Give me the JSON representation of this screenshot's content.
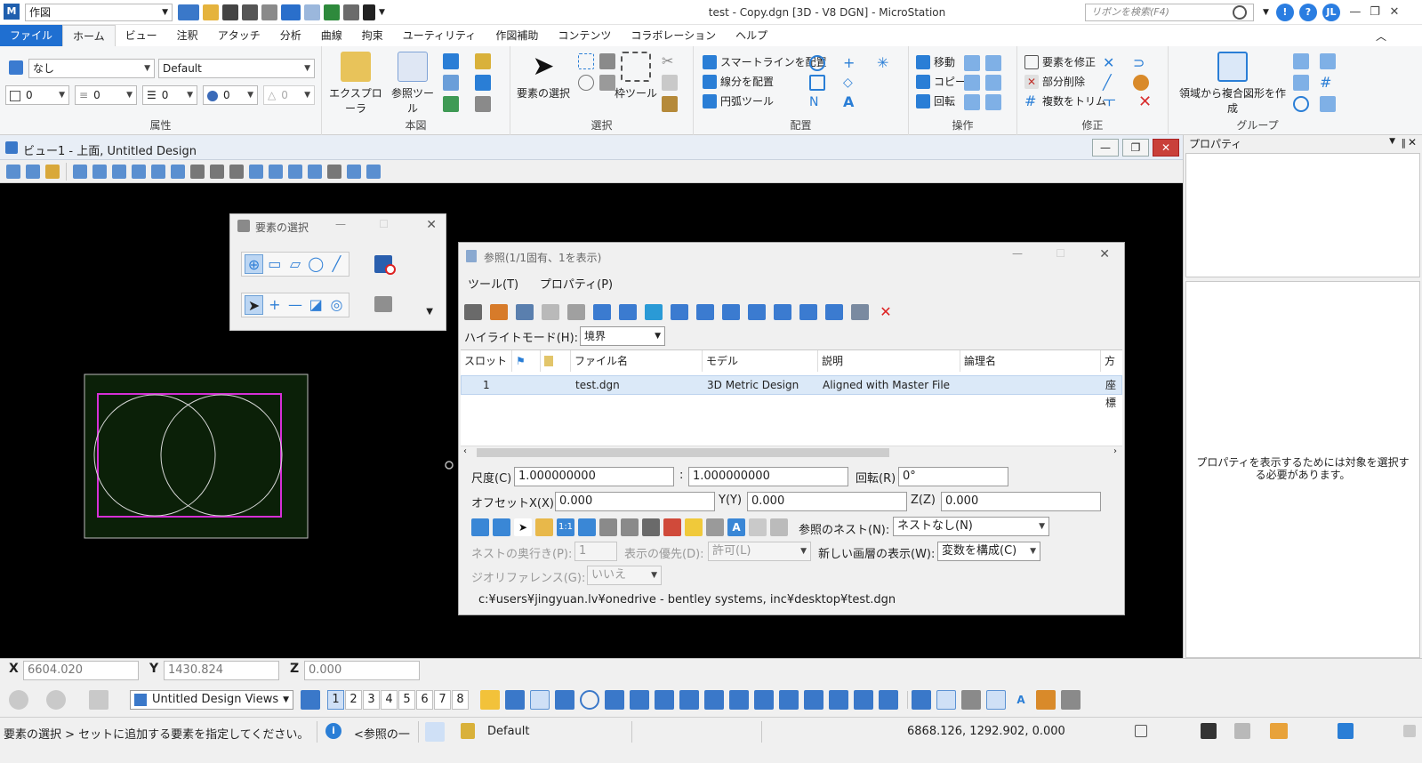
{
  "app": {
    "workflow": "作図",
    "window_title": "test - Copy.dgn [3D - V8 DGN] - MicroStation",
    "search_placeholder": "リボンを検索(F4)",
    "user_initials": "JL"
  },
  "tabs": [
    "ファイル",
    "ホーム",
    "ビュー",
    "注釈",
    "アタッチ",
    "分析",
    "曲線",
    "拘束",
    "ユーティリティ",
    "作図補助",
    "コンテンツ",
    "コラボレーション",
    "ヘルプ"
  ],
  "ribbon": {
    "attributes": {
      "level": "なし",
      "style": "Default",
      "color": "0",
      "linestyle": "0",
      "weight": "0",
      "transparency": "0",
      "priority": "0",
      "label": "属性"
    },
    "primary": {
      "explorer": "エクスプローラ",
      "ref_tools": "参照ツール",
      "label": "本図"
    },
    "selection": {
      "element_select": "要素の選択",
      "fence_tools": "枠ツール",
      "label": "選択"
    },
    "placement": {
      "smartline": "スマートラインを配置",
      "line": "線分を配置",
      "arc": "円弧ツール",
      "label": "配置"
    },
    "manipulate": {
      "move": "移動",
      "copy": "コピー",
      "rotate": "回転",
      "label": "操作"
    },
    "modify": {
      "modify": "要素を修正",
      "partial_delete": "部分削除",
      "trim": "複数をトリム",
      "label": "修正"
    },
    "groups": {
      "create_region": "領域から複合図形を作成",
      "label": "グループ"
    }
  },
  "view": {
    "title": "ビュー1 - 上面, Untitled Design"
  },
  "properties": {
    "title": "プロパティ",
    "message": "プロパティを表示するためには対象を選択する必要があります。"
  },
  "select_dialog": {
    "title": "要素の選択"
  },
  "ref_dialog": {
    "title": "参照(1/1固有、1を表示)",
    "menu": [
      "ツール(T)",
      "プロパティ(P)"
    ],
    "highlight_label": "ハイライトモード(H):",
    "highlight_value": "境界",
    "columns": [
      "スロット",
      "",
      "",
      "ファイル名",
      "モデル",
      "説明",
      "論理名",
      "方向"
    ],
    "row": {
      "slot": "1",
      "file": "test.dgn",
      "model": "3D Metric Design",
      "description": "Aligned with Master File",
      "logical": "",
      "orientation": "座標"
    },
    "scale_label": "尺度(C)",
    "scale1": "1.000000000",
    "scale_sep": ":",
    "scale2": "1.000000000",
    "rotation_label": "回転(R)",
    "rotation": "0°",
    "offset_x_label": "オフセットX(X)",
    "offset_x": "0.000",
    "offset_y_label": "Y(Y)",
    "offset_y": "0.000",
    "offset_z_label": "Z(Z)",
    "offset_z": "0.000",
    "nest_label": "参照のネスト(N):",
    "nest_value": "ネストなし(N)",
    "depth_label": "ネストの奥行き(P):",
    "depth_value": "1",
    "display_label": "表示の優先(D):",
    "display_value": "許可(L)",
    "newlevel_label": "新しい画層の表示(W):",
    "newlevel_value": "変数を構成(C)",
    "georef_label": "ジオリファレンス(G):",
    "georef_value": "いいえ",
    "path": "c:¥users¥jingyuan.lv¥onedrive - bentley systems, inc¥desktop¥test.dgn"
  },
  "coords": {
    "x_label": "X",
    "x": "6604.020",
    "y_label": "Y",
    "y": "1430.824",
    "z_label": "Z",
    "z": "0.000"
  },
  "bottom": {
    "views_name": "Untitled Design Views",
    "view_numbers": [
      "1",
      "2",
      "3",
      "4",
      "5",
      "6",
      "7",
      "8"
    ]
  },
  "status": {
    "prompt": "要素の選択 > セットに追加する要素を指定してください。",
    "info": "<参照の一",
    "level": "Default",
    "position": "6868.126, 1292.902, 0.000"
  },
  "colors": {
    "accent": "#1f6fd1",
    "canvas": "#000000",
    "fence": "#d62fd6",
    "model_bg": "#0b2008"
  }
}
